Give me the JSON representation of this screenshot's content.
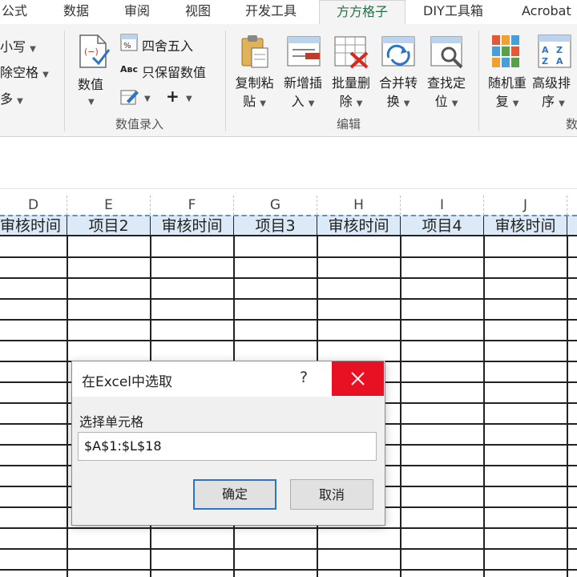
{
  "tabs": [
    {
      "label": "公式",
      "active": false
    },
    {
      "label": "数据",
      "active": false
    },
    {
      "label": "审阅",
      "active": false
    },
    {
      "label": "视图",
      "active": false
    },
    {
      "label": "开发工具",
      "active": false
    },
    {
      "label": "方方格子",
      "active": true
    },
    {
      "label": "DIY工具箱",
      "active": false
    },
    {
      "label": "Acrobat",
      "active": false
    }
  ],
  "ribbon": {
    "left_partial": {
      "case_label": "小写",
      "trim_label": "除空格",
      "more_label": "多"
    },
    "numeric_entry": {
      "value_button": "数值",
      "round_label": "四舍五入",
      "keep_values_label": "只保留数值",
      "plus_label": "+",
      "group_label": "数值录入"
    },
    "edit": {
      "copy_paste": [
        "复制粘",
        "贴"
      ],
      "add_insert": [
        "新增插",
        "入"
      ],
      "batch_delete": [
        "批量删",
        "除"
      ],
      "merge_convert": [
        "合并转",
        "换"
      ],
      "find_locate": [
        "查找定",
        "位"
      ],
      "group_label": "编辑"
    },
    "data_group": {
      "random_repeat": [
        "随机重",
        "复"
      ],
      "advanced_sort": [
        "高级排",
        "序"
      ],
      "group_label_partial": "数"
    }
  },
  "sheet": {
    "columns": [
      "D",
      "E",
      "F",
      "G",
      "H",
      "I",
      "J"
    ],
    "header_cells": [
      "审核时间",
      "项目2",
      "审核时间",
      "项目3",
      "审核时间",
      "项目4",
      "审核时间"
    ]
  },
  "dialog": {
    "title": "在Excel中选取",
    "help": "?",
    "close_symbol": "✕",
    "field_label": "选择单元格",
    "field_value": "$A$1:$L$18",
    "ok_label": "确定",
    "cancel_label": "取消"
  },
  "colors": {
    "accent_tab": "#217346",
    "close_red": "#e81123",
    "header_fill": "#dce9f6",
    "default_button_border": "#2e74c5"
  }
}
